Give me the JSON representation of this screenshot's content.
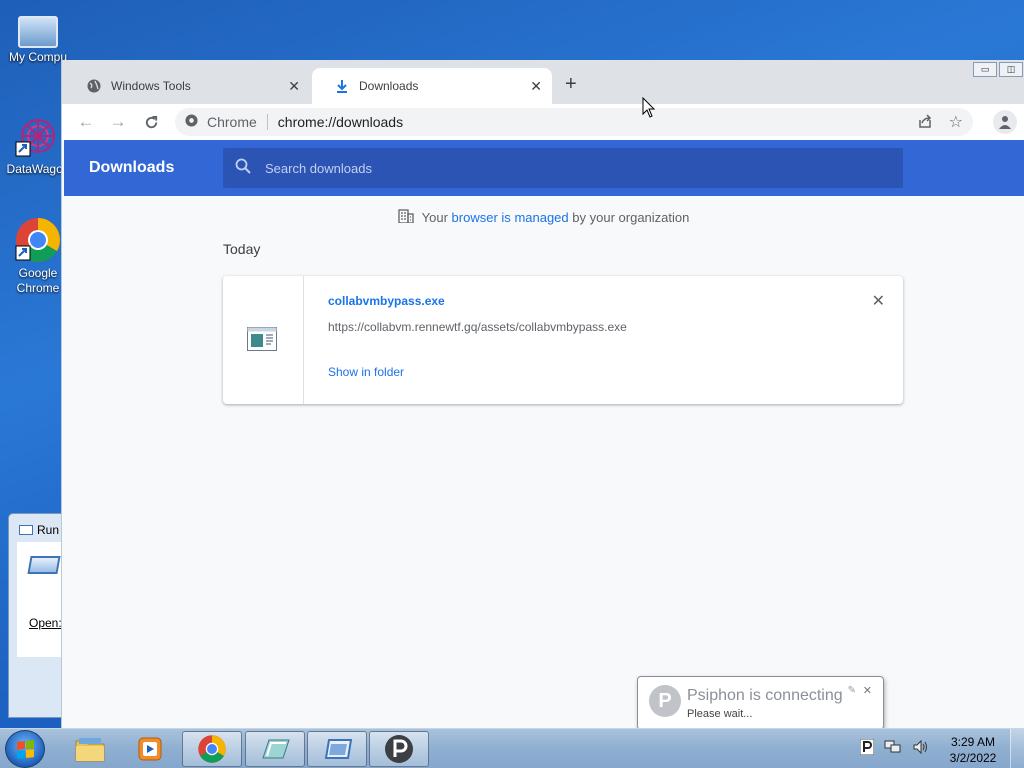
{
  "desktop": {
    "icons": [
      {
        "label": "My Compu",
        "icon": "computer-icon"
      },
      {
        "label": "DataWagon",
        "icon": "datawagon-icon"
      },
      {
        "label": "Google Chrome",
        "icon": "chrome-icon"
      }
    ]
  },
  "run_dialog": {
    "title": "Run",
    "open_label": "Open:"
  },
  "browser": {
    "tabs": [
      {
        "label": "Windows Tools",
        "icon": "globe-icon",
        "active": false
      },
      {
        "label": "Downloads",
        "icon": "download-icon",
        "active": true
      }
    ],
    "new_tab_label": "+",
    "omnibox": {
      "site_label": "Chrome",
      "url": "chrome://downloads"
    }
  },
  "downloads": {
    "title": "Downloads",
    "search_placeholder": "Search downloads",
    "managed_notice": {
      "prefix": "Your",
      "link1": "browser",
      "middle": "is",
      "link2": "managed",
      "suffix": "by your organization"
    },
    "section_date": "Today",
    "items": [
      {
        "filename": "collabvmbypass.exe",
        "url": "https://collabvm.rennewtf.gq/assets/collabvmbypass.exe",
        "action": "Show in folder"
      }
    ]
  },
  "notification": {
    "title": "Psiphon is connecting",
    "message": "Please wait..."
  },
  "taskbar": {
    "apps": [
      "explorer-icon",
      "media-player-icon",
      "chrome-icon",
      "rdp-icon",
      "run-icon",
      "psiphon-icon"
    ],
    "clock": {
      "time": "3:29 AM",
      "date": "3/2/2022"
    }
  },
  "colors": {
    "accent": "#3367d6",
    "link": "#1a73e8",
    "header_search": "#2c54b5"
  }
}
